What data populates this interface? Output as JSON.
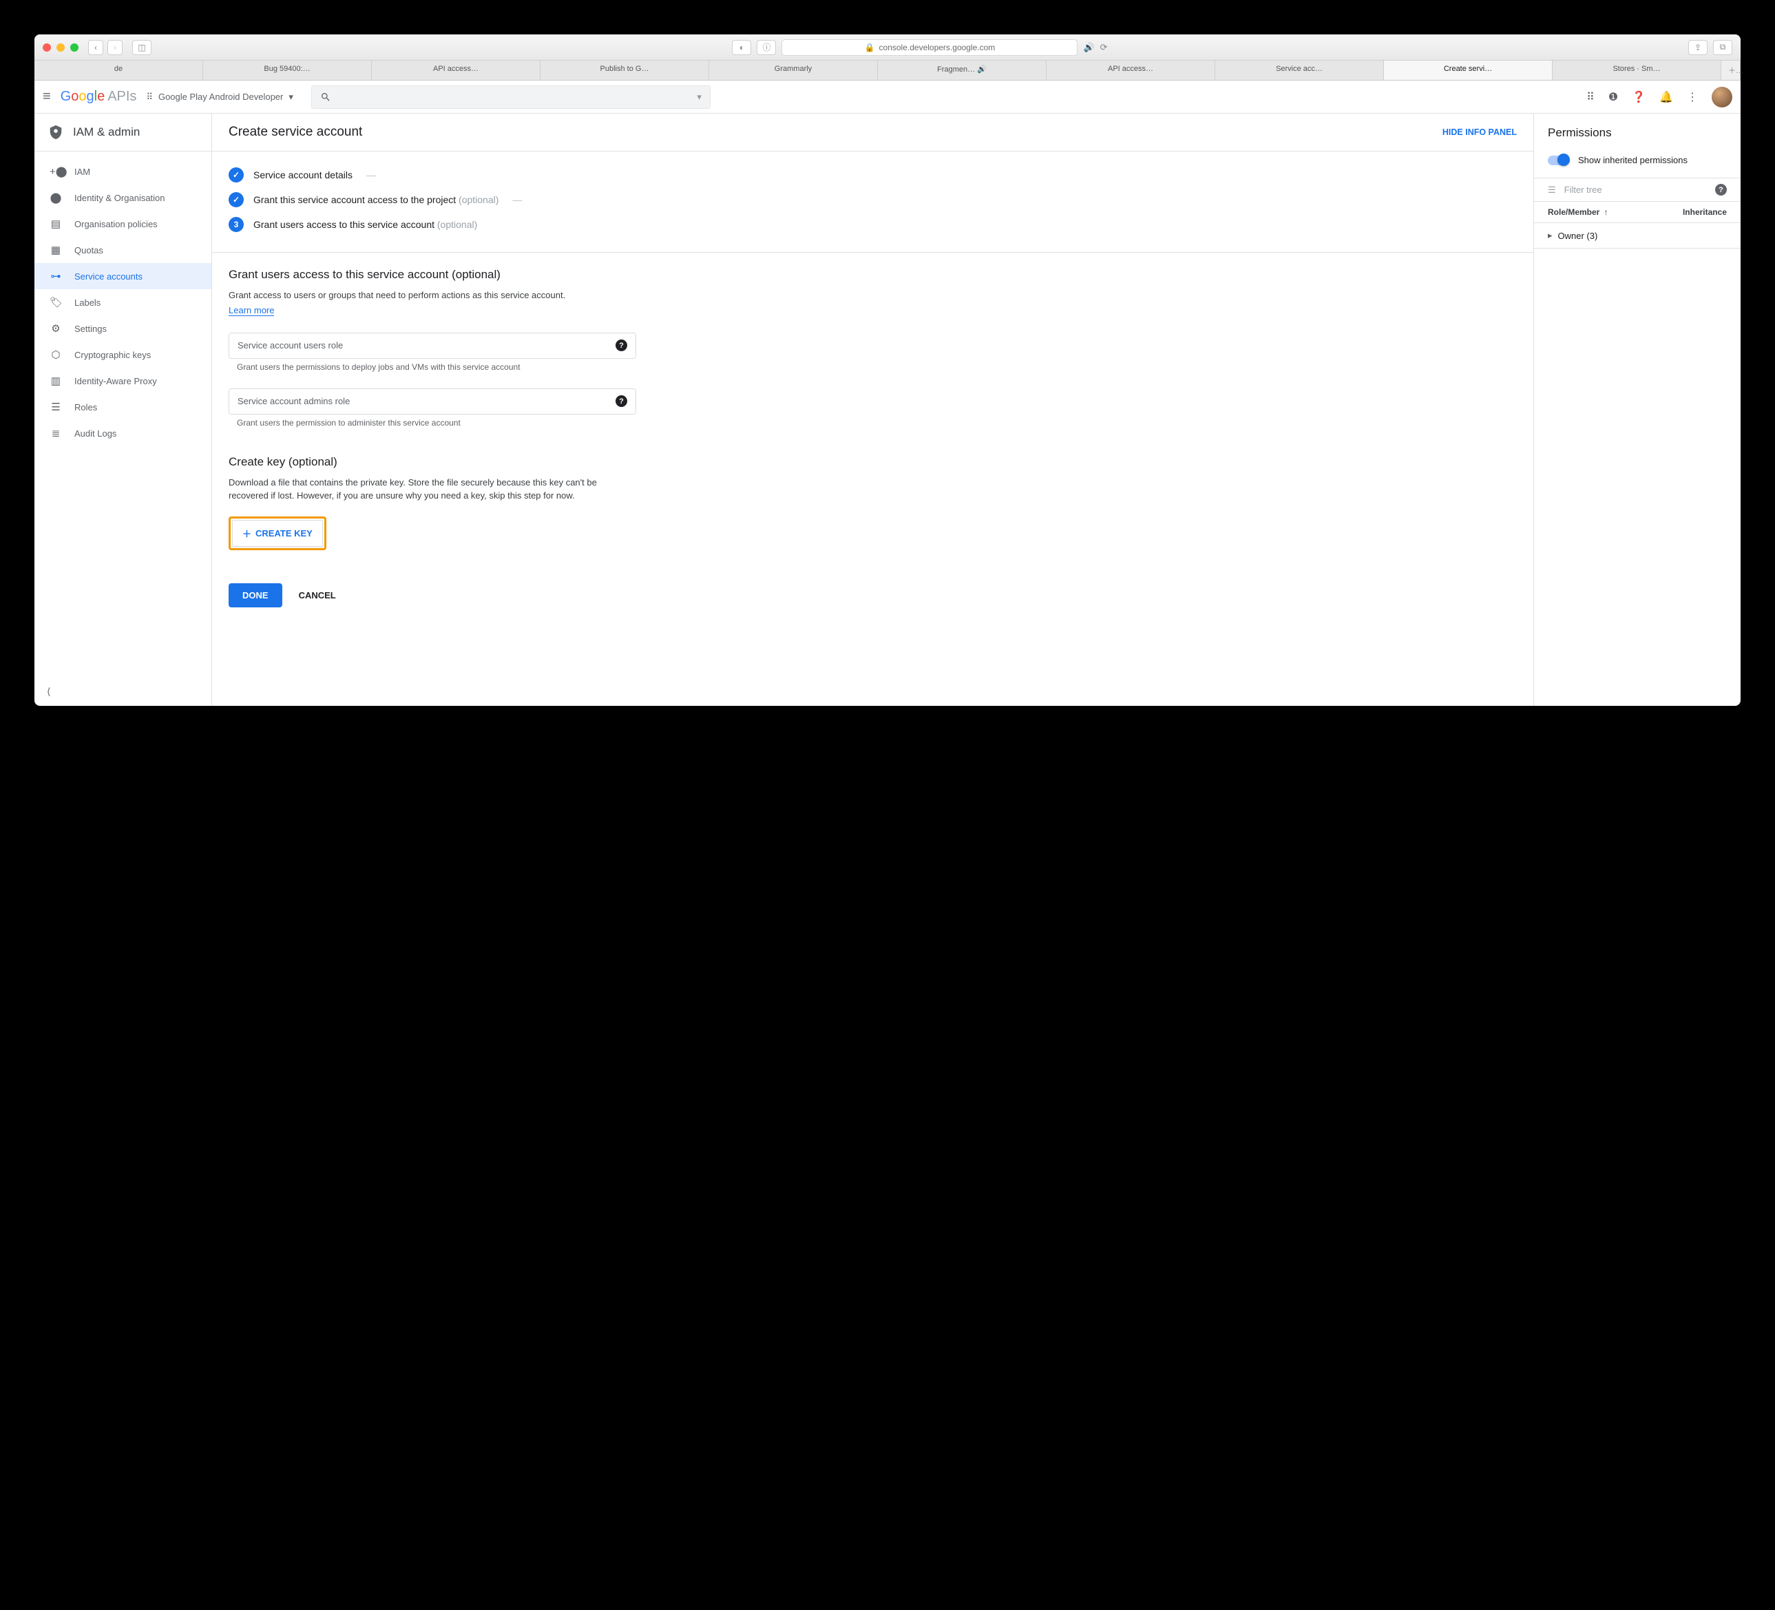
{
  "browser": {
    "url": "console.developers.google.com",
    "tabs": [
      "de",
      "Bug 59400:…",
      "API access…",
      "Publish to G…",
      "Grammarly",
      "Fragmen…",
      "API access…",
      "Service acc…",
      "Create servi…",
      "Stores · Sm…"
    ]
  },
  "header": {
    "logo_apis": "APIs",
    "project": "Google Play Android Developer"
  },
  "sidebar": {
    "title": "IAM & admin",
    "items": [
      {
        "label": "IAM"
      },
      {
        "label": "Identity & Organisation"
      },
      {
        "label": "Organisation policies"
      },
      {
        "label": "Quotas"
      },
      {
        "label": "Service accounts"
      },
      {
        "label": "Labels"
      },
      {
        "label": "Settings"
      },
      {
        "label": "Cryptographic keys"
      },
      {
        "label": "Identity-Aware Proxy"
      },
      {
        "label": "Roles"
      },
      {
        "label": "Audit Logs"
      }
    ]
  },
  "content": {
    "title": "Create service account",
    "hide_panel": "HIDE INFO PANEL",
    "steps": {
      "s1": "Service account details",
      "s2": "Grant this service account access to the project",
      "s3": "Grant users access to this service account",
      "optional": "(optional)"
    },
    "form": {
      "h2a": "Grant users access to this service account (optional)",
      "desc_a": "Grant access to users or groups that need to perform actions as this service account.",
      "learn_more": "Learn more",
      "field1_ph": "Service account users role",
      "hint1": "Grant users the permissions to deploy jobs and VMs with this service account",
      "field2_ph": "Service account admins role",
      "hint2": "Grant users the permission to administer this service account",
      "h2b": "Create key (optional)",
      "desc_b": "Download a file that contains the private key. Store the file securely because this key can't be recovered if lost. However, if you are unsure why you need a key, skip this step for now.",
      "create_key": "CREATE KEY",
      "done": "DONE",
      "cancel": "CANCEL"
    }
  },
  "panel": {
    "title": "Permissions",
    "toggle_label": "Show inherited permissions",
    "filter_ph": "Filter tree",
    "col1": "Role/Member",
    "col2": "Inheritance",
    "row1": "Owner (3)"
  }
}
